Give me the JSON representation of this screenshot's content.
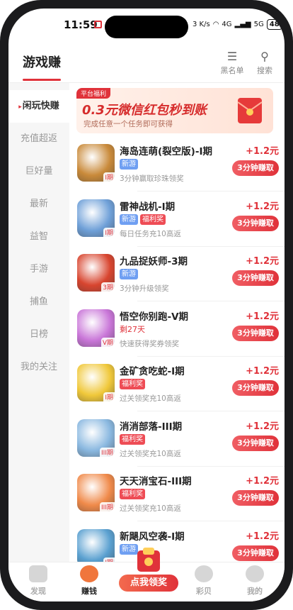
{
  "status_bar": {
    "time": "11:59",
    "battery": "48",
    "network_1": "4G",
    "network_2": "5G",
    "speed": "3 K/s"
  },
  "header": {
    "title": "游戏赚",
    "blacklist_label": "黑名单",
    "search_label": "搜索"
  },
  "sidebar": {
    "items": [
      {
        "label": "闲玩快赚",
        "active": true
      },
      {
        "label": "充值超返"
      },
      {
        "label": "巨好量"
      },
      {
        "label": "最新"
      },
      {
        "label": "益智"
      },
      {
        "label": "手游"
      },
      {
        "label": "捕鱼"
      },
      {
        "label": "日榜"
      },
      {
        "label": "我的关注"
      }
    ]
  },
  "banner": {
    "tag": "平台福利",
    "headline": "0.3元微信红包秒到账",
    "subtitle": "完成任意一个任务即可获得"
  },
  "games": [
    {
      "name": "海岛连萌(裂空版)-I期",
      "badges": [
        "新游"
      ],
      "desc": "3分钟赢取珍珠领奖",
      "period": "I期",
      "reward": "+1.2元",
      "button": "3分钟赚取",
      "color": "#c98a3a"
    },
    {
      "name": "雷神战机-I期",
      "badges": [
        "新游",
        "福利奖"
      ],
      "desc": "每日任务充10高返",
      "period": "I期",
      "reward": "+1.2元",
      "button": "3分钟赚取",
      "color": "#6fa0d8"
    },
    {
      "name": "九品捉妖师-3期",
      "badges": [
        "新游"
      ],
      "desc": "3分钟升级领奖",
      "period": "3期",
      "reward": "+1.2元",
      "button": "3分钟赚取",
      "color": "#d8452f"
    },
    {
      "name": "悟空你别跑-V期",
      "badges": [
        "剩27天"
      ],
      "desc": "快速获得奖券领奖",
      "period": "V期",
      "reward": "+1.2元",
      "button": "3分钟赚取",
      "color": "#c976d8"
    },
    {
      "name": "金矿贪吃蛇-I期",
      "badges": [
        "福利奖"
      ],
      "desc": "过关领奖充10高返",
      "period": "I期",
      "reward": "+1.2元",
      "button": "3分钟赚取",
      "color": "#f0c83a"
    },
    {
      "name": "消消部落-III期",
      "badges": [
        "福利奖"
      ],
      "desc": "过关领奖充10高返",
      "period": "III期",
      "reward": "+1.2元",
      "button": "3分钟赚取",
      "color": "#8ab8e0"
    },
    {
      "name": "天天消宝石-III期",
      "badges": [
        "福利奖"
      ],
      "desc": "过关领奖充10高返",
      "period": "III期",
      "reward": "+1.2元",
      "button": "3分钟赚取",
      "color": "#f08a4a"
    },
    {
      "name": "新飓风空袭-I期",
      "badges": [
        "新游"
      ],
      "desc": "",
      "period": "I期",
      "reward": "+1.2元",
      "button": "3分钟赚取",
      "color": "#5aa0d0"
    }
  ],
  "tabbar": {
    "items": [
      {
        "label": "发现"
      },
      {
        "label": "赚钱",
        "active": true
      },
      {
        "label": "点我领奖"
      },
      {
        "label": "彩贝"
      },
      {
        "label": "我的"
      }
    ]
  },
  "colors": {
    "accent": "#e0323a",
    "badge_new": "#6f9ff2",
    "badge_welfare": "#ee4c55"
  }
}
